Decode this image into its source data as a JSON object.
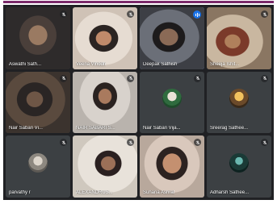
{
  "app": {
    "accent_color": "#7a2a6a",
    "grid_background": "#202124",
    "active_outline_color": "#8ab4f8"
  },
  "participants": [
    {
      "name": "Aswathi Sath...",
      "muted": true,
      "avatar": false
    },
    {
      "name": "Veena Vinodh",
      "muted": true,
      "avatar": false
    },
    {
      "name": "Deepak Sathish",
      "muted": false,
      "speaking": true,
      "avatar": false
    },
    {
      "name": "Sheeja Ishit...",
      "muted": true,
      "avatar": false
    },
    {
      "name": "Nair Sabari Vi...",
      "muted": true,
      "avatar": false
    },
    {
      "name": "NAIR SABARI S...",
      "muted": true,
      "avatar": false
    },
    {
      "name": "Nair Sabari Vija...",
      "muted": true,
      "avatar": true
    },
    {
      "name": "Sreerag Sathee...",
      "muted": true,
      "avatar": true
    },
    {
      "name": "parvathy r",
      "muted": true,
      "avatar": true
    },
    {
      "name": "ALEXANDRUS...",
      "muted": true,
      "avatar": false
    },
    {
      "name": "Suhana Ashraf",
      "muted": true,
      "avatar": false
    },
    {
      "name": "Adharsh Sathee...",
      "muted": true,
      "avatar": true
    }
  ]
}
